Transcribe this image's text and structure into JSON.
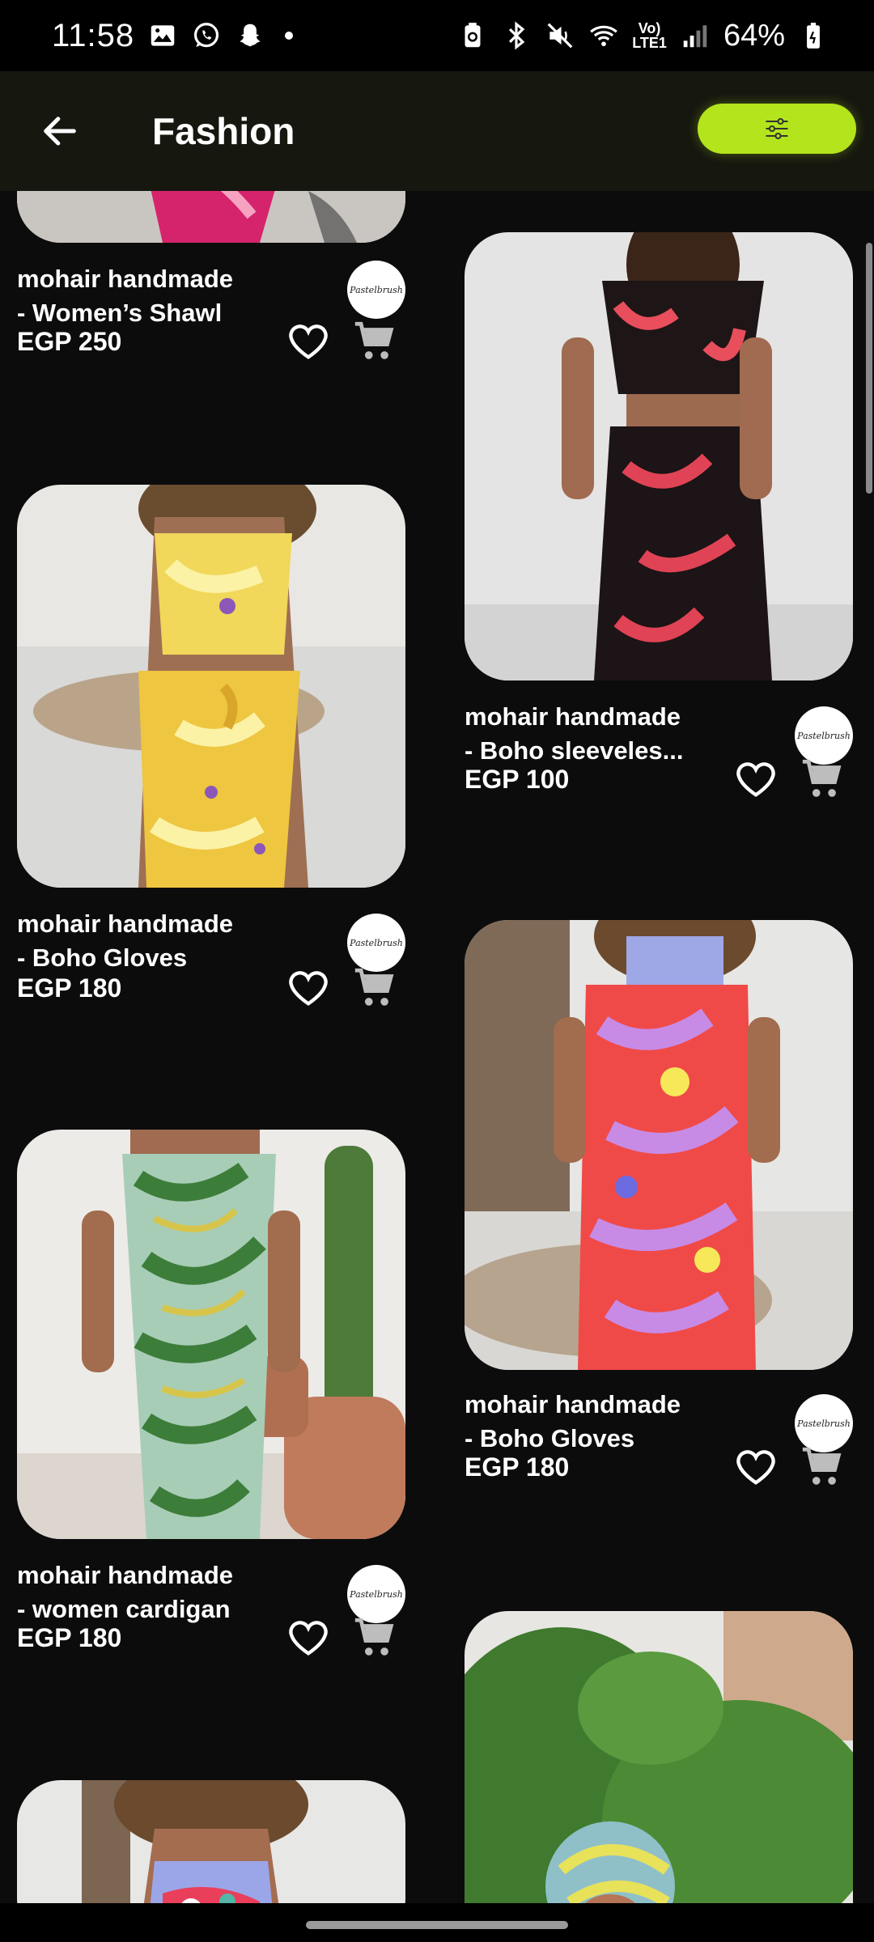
{
  "status_bar": {
    "time": "11:58",
    "network_label": "Vo)\nLTE1",
    "battery": "64%"
  },
  "app_bar": {
    "title": "Fashion"
  },
  "colors": {
    "accent": "#b4e41c",
    "background": "#0c0c0c",
    "app_bar": "#16170f"
  },
  "products": [
    {
      "title": "mohair handmade\n- Women’s Shawl",
      "price": "EGP 250",
      "seller_logo": "Pastelbrush"
    },
    {
      "title": "mohair handmade\n- Boho sleeveles...",
      "price": "EGP 100",
      "seller_logo": "Pastelbrush"
    },
    {
      "title": "mohair handmade\n- Boho Gloves",
      "price": "EGP 180",
      "seller_logo": "Pastelbrush"
    },
    {
      "title": "mohair handmade\n- Boho Gloves",
      "price": "EGP 180",
      "seller_logo": "Pastelbrush"
    },
    {
      "title": "mohair handmade\n- women cardigan",
      "price": "EGP 180",
      "seller_logo": "Pastelbrush"
    }
  ],
  "icons": {
    "back": "arrow-left-icon",
    "filter": "sliders-icon",
    "favorite": "heart-outline-icon",
    "cart": "shopping-cart-icon"
  }
}
